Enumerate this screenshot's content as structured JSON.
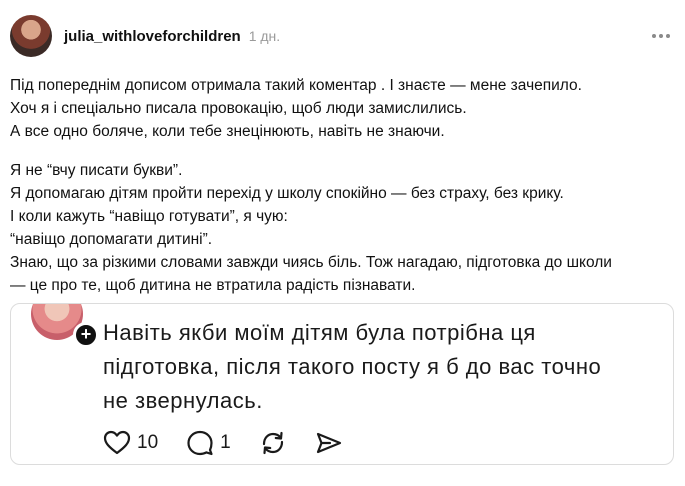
{
  "post": {
    "username": "julia_withloveforchildren",
    "time": "1 дн.",
    "paragraphs": [
      [
        "Під попереднім дописом отримала такий коментар . І знаєте — мене зачепило.",
        "Хоч я і спеціально писала провокацію, щоб люди замислились.",
        "А все одно боляче, коли тебе знецінюють, навіть не знаючи."
      ],
      [
        "Я не “вчу писати букви”.",
        "Я допомагаю дітям пройти перехід у школу спокійно — без страху, без крику.",
        "І коли кажуть “навіщо готувати”, я чую:",
        "“навіщо допомагати дитині”.",
        "Знаю, що за різкими словами завжди чиясь біль. Тож нагадаю, підготовка до школи",
        "— це про те, щоб дитина не втратила радість пізнавати."
      ]
    ]
  },
  "embed": {
    "plus": "+",
    "lines": [
      "Навіть якби моїм дітям була потрібна ця",
      "підготовка, після такого посту я б до вас точно",
      "не звернулась."
    ],
    "likes": "10",
    "replies": "1",
    "icons": [
      "heart-icon",
      "comment-icon",
      "repost-icon",
      "share-icon"
    ]
  }
}
